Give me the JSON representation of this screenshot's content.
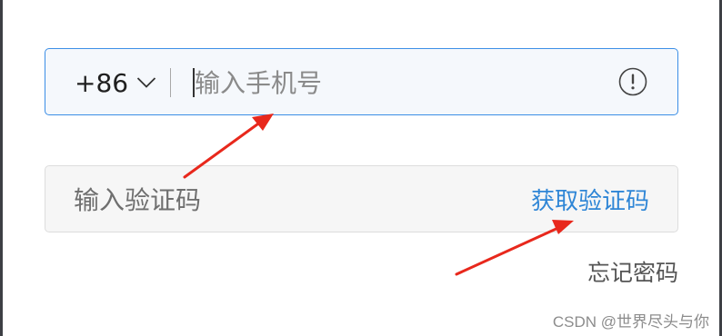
{
  "phone_field": {
    "country_code": "+86",
    "placeholder": "输入手机号",
    "value": "",
    "info_icon": "exclamation-circle-icon",
    "chevron_icon": "chevron-down-icon"
  },
  "code_field": {
    "placeholder": "输入验证码",
    "value": "",
    "get_code_label": "获取验证码"
  },
  "forgot_password_label": "忘记密码",
  "watermark": "CSDN @世界尽头与你",
  "annotations": {
    "arrow_color": "#e8281c",
    "arrow_count": 2
  },
  "colors": {
    "focus_border": "#3b8ee6",
    "link_blue": "#2f86d6",
    "input_bg": "#f6f6f6"
  }
}
